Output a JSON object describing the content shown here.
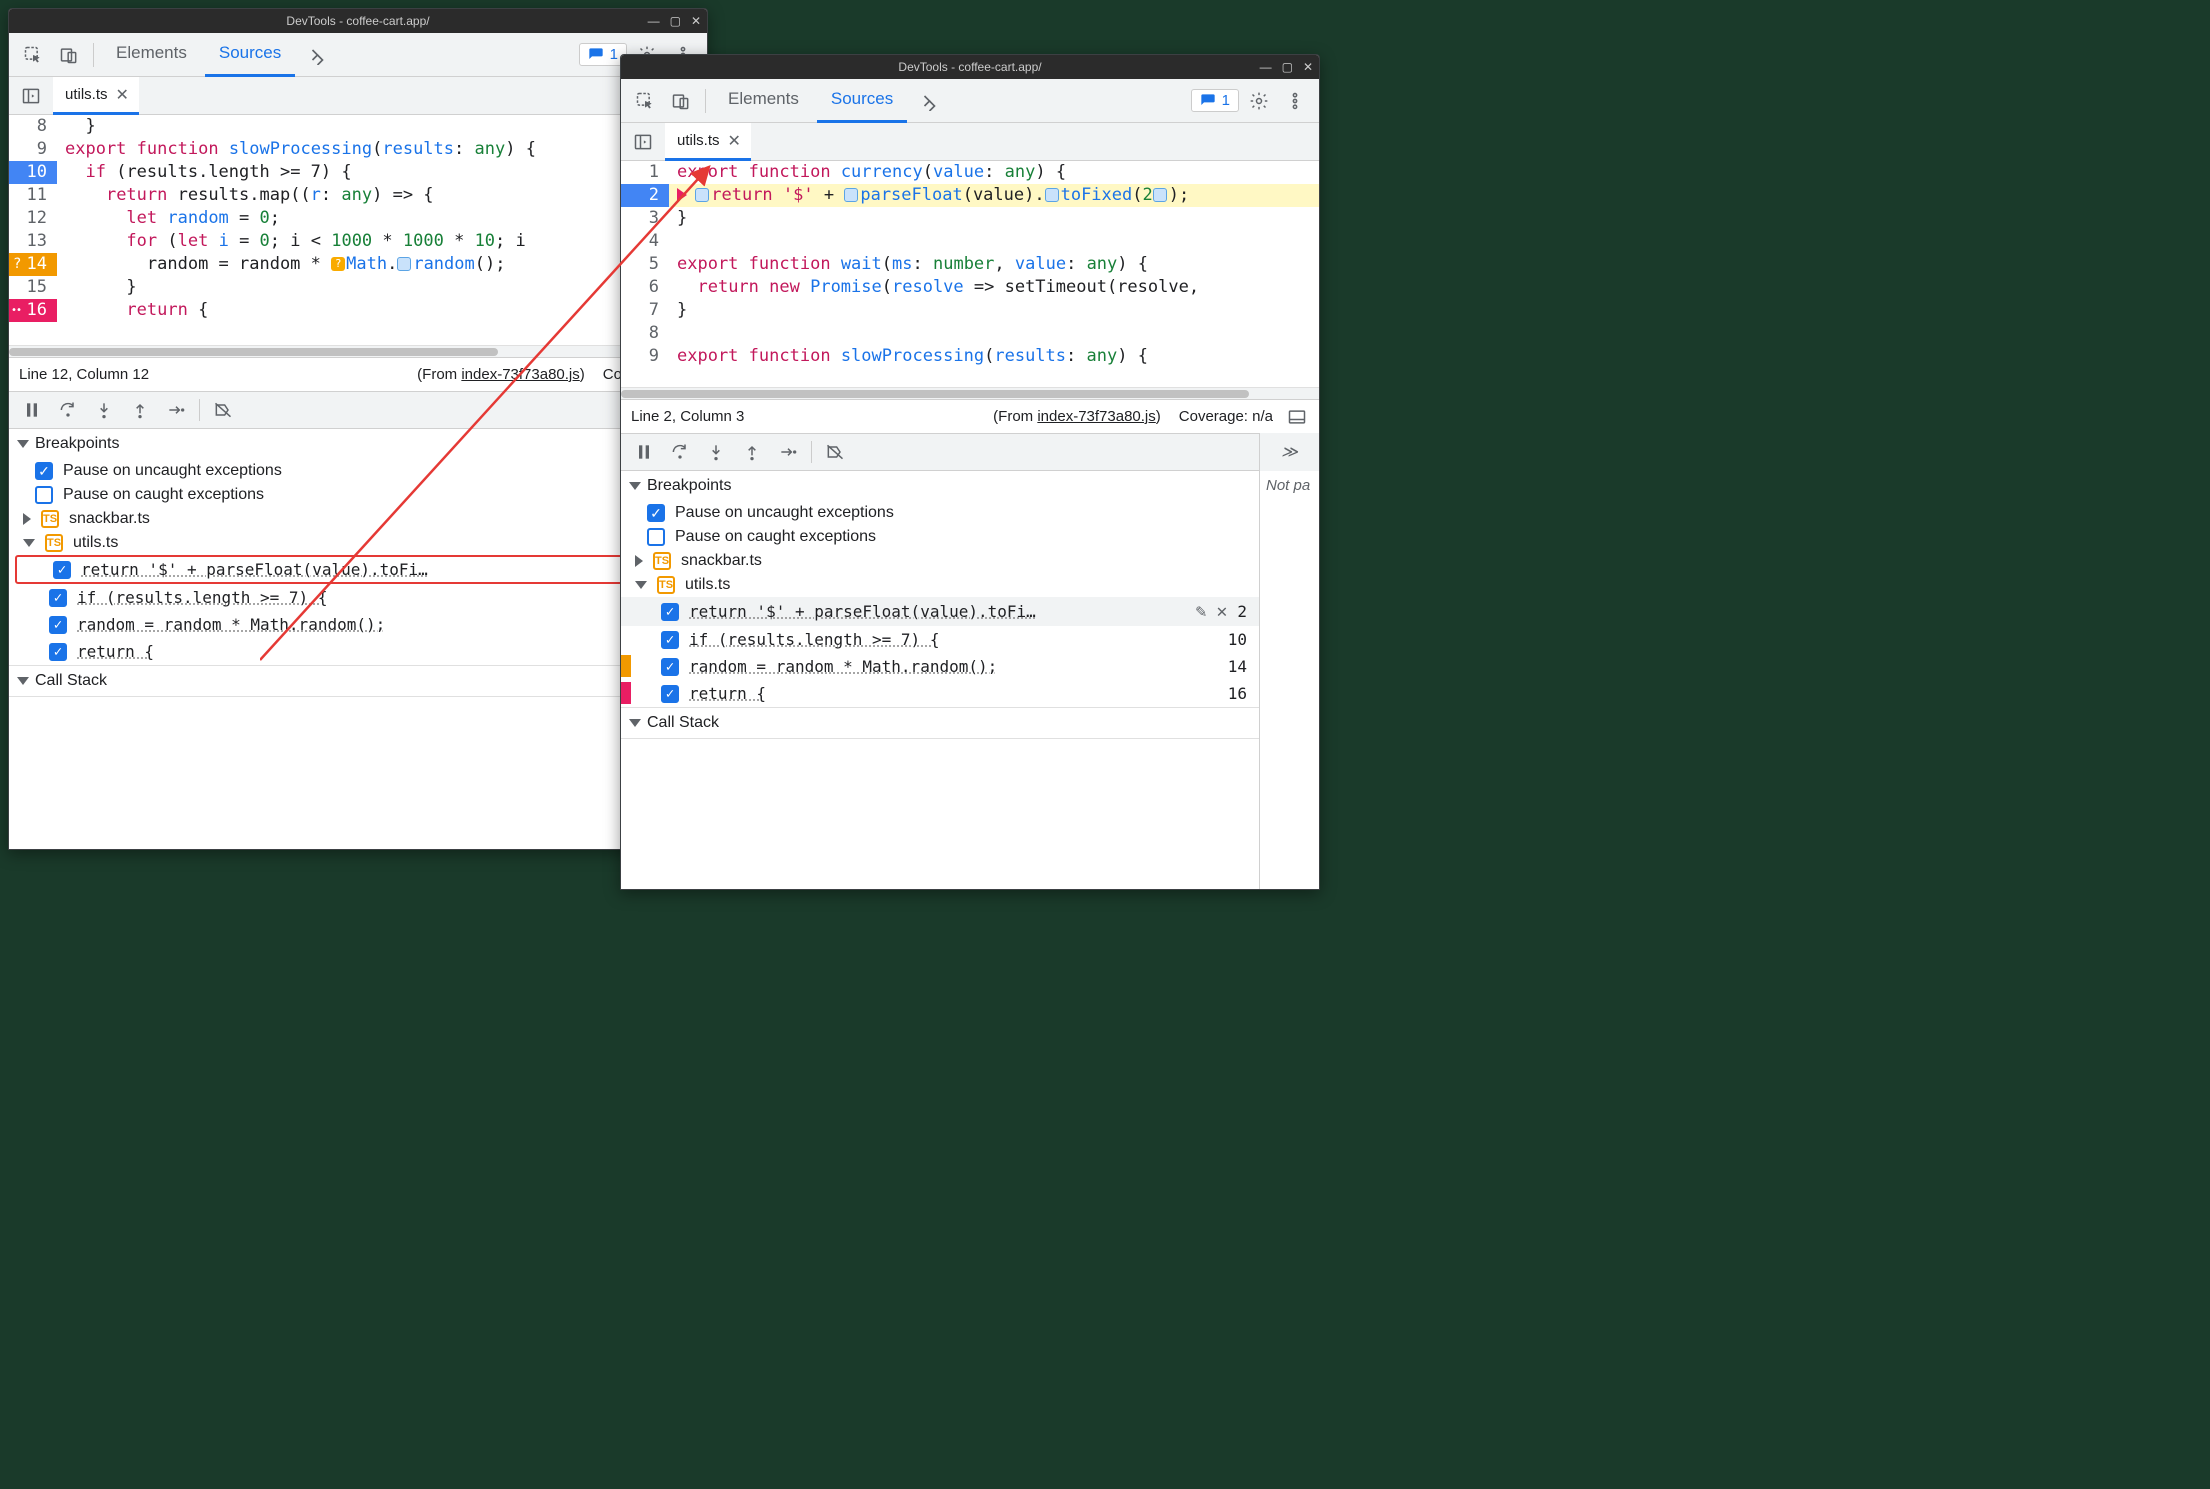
{
  "titlebar": {
    "title": "DevTools - coffee-cart.app/"
  },
  "tabs": {
    "elements": "Elements",
    "sources": "Sources"
  },
  "issues": {
    "count": "1"
  },
  "filetab": {
    "name": "utils.ts"
  },
  "left": {
    "status": {
      "pos": "Line 12, Column 12",
      "from_prefix": "(From ",
      "from_link": "index-73f73a80.js",
      "from_suffix": ")",
      "coverage": "Coverage: n/a"
    },
    "code": {
      "l8": {
        "n": "8",
        "t": "}"
      },
      "l9": {
        "n": "9",
        "kw1": "export",
        "kw2": "function",
        "fn": "slowProcessing",
        "p": "(",
        "pid": "results",
        "col": ": ",
        "ty": "any",
        "p2": ") {"
      },
      "l10": {
        "n": "10",
        "kw": "if",
        "rest": " (results.length >= 7) {"
      },
      "l11": {
        "n": "11",
        "kw": "return",
        "rest": " results.map((",
        "pid": "r",
        "col": ": ",
        "ty": "any",
        "p2": ") => {"
      },
      "l12": {
        "n": "12",
        "kw": "let",
        "id": " random",
        "rest": " = ",
        "num": "0",
        "semi": ";"
      },
      "l13": {
        "n": "13",
        "kw": "for",
        "rest": " (",
        "kw2": "let",
        "id": " i",
        "eq": " = ",
        "n0": "0",
        "mid": "; i < ",
        "n1": "1000",
        "star": " * ",
        "n2": "1000",
        "star2": " * ",
        "n3": "10",
        "end": "; i"
      },
      "l14": {
        "n": "14",
        "pre": "random = random * ",
        "obj": "Math",
        "dot": ".",
        "me": "random",
        "call": "();"
      },
      "l15": {
        "n": "15",
        "t": "}"
      },
      "l16": {
        "n": "16",
        "kw": "return",
        "rest": " {"
      }
    }
  },
  "right": {
    "status": {
      "pos": "Line 2, Column 3",
      "from_prefix": "(From ",
      "from_link": "index-73f73a80.js",
      "from_suffix": ")",
      "coverage": "Coverage: n/a"
    },
    "notpaused": "Not pa",
    "code": {
      "l1": {
        "n": "1",
        "kw1": "export",
        "kw2": "function",
        "fn": "currency",
        "p": "(",
        "pid": "value",
        "col": ": ",
        "ty": "any",
        "p2": ") {"
      },
      "l2": {
        "n": "2",
        "kw": "return",
        "str": " '$'",
        "plus": " + ",
        "fn": "parseFloat",
        "args": "(value).",
        "me": "toFixed",
        "args2": "(",
        "num": "2",
        "args3": ");"
      },
      "l3": {
        "n": "3",
        "t": "}"
      },
      "l4": {
        "n": "4",
        "t": ""
      },
      "l5": {
        "n": "5",
        "kw1": "export",
        "kw2": "function",
        "fn": "wait",
        "p": "(",
        "pid": "ms",
        "col": ": ",
        "ty": "number",
        "comma": ", ",
        "pid2": "value",
        "col2": ": ",
        "ty2": "any",
        "p2": ") {"
      },
      "l6": {
        "n": "6",
        "kw": "return",
        "kw2": " new",
        "cls": " Promise",
        "rest": "(",
        "pid": "resolve",
        "arr": " => setTimeout(resolve,"
      },
      "l7": {
        "n": "7",
        "t": "}"
      },
      "l8": {
        "n": "8",
        "t": ""
      },
      "l9": {
        "n": "9",
        "kw1": "export",
        "kw2": "function",
        "fn": "slowProcessing",
        "p": "(",
        "pid": "results",
        "col": ": ",
        "ty": "any",
        "p2": ") {"
      }
    }
  },
  "panes": {
    "breakpoints": "Breakpoints",
    "pause_uncaught": "Pause on uncaught exceptions",
    "pause_caught": "Pause on caught exceptions",
    "snackbar": "snackbar.ts",
    "utils": "utils.ts",
    "bp1": {
      "txt": "return '$' + parseFloat(value).toFi…",
      "ln": "2"
    },
    "bp1r": {
      "txt": "return '$' + parseFloat(value).toFi…",
      "ln": "2"
    },
    "bp2": {
      "txt": "if (results.length >= 7) {",
      "ln": "10"
    },
    "bp3": {
      "txt": "random = random * Math.random();",
      "ln": "14"
    },
    "bp4": {
      "txt": "return {",
      "ln": "16"
    },
    "callstack": "Call Stack"
  }
}
